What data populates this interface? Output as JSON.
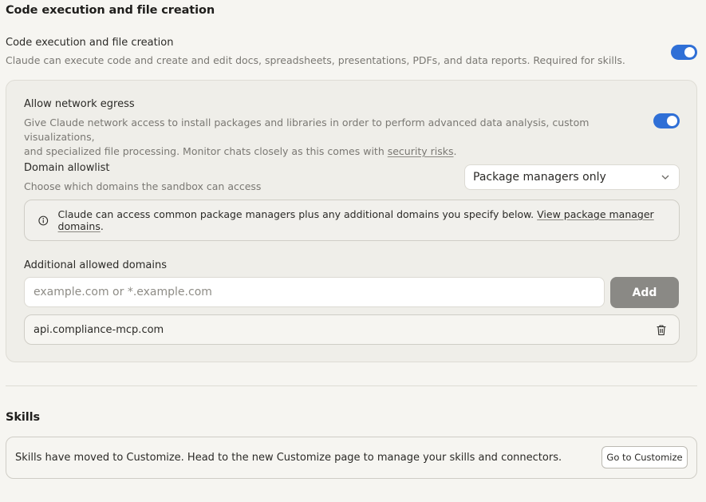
{
  "section1": {
    "title": "Code execution and file creation",
    "setting_label": "Code execution and file creation",
    "setting_desc": "Claude can execute code and create and edit docs, spreadsheets, presentations, PDFs, and data reports. Required for skills.",
    "toggle_on": true
  },
  "egress": {
    "label": "Allow network egress",
    "desc_line1": "Give Claude network access to install packages and libraries in order to perform advanced data analysis, custom visualizations,",
    "desc_line2_prefix": "and specialized file processing. Monitor chats closely as this comes with ",
    "desc_link": "security risks",
    "desc_suffix": ".",
    "toggle_on": true
  },
  "allowlist": {
    "label": "Domain allowlist",
    "desc": "Choose which domains the sandbox can access",
    "selected": "Package managers only"
  },
  "info": {
    "text": "Claude can access common package managers plus any additional domains you specify below. ",
    "link": "View package manager domains",
    "suffix": "."
  },
  "additional": {
    "label": "Additional allowed domains",
    "placeholder": "example.com or *.example.com",
    "add_label": "Add",
    "domains": [
      "api.compliance-mcp.com"
    ]
  },
  "skills": {
    "title": "Skills",
    "text": "Skills have moved to Customize. Head to the new Customize page to manage your skills and connectors.",
    "button": "Go to Customize"
  },
  "colors": {
    "accent": "#2f6fd6",
    "background": "#f6f5f1",
    "add_button": "#8a8985"
  }
}
